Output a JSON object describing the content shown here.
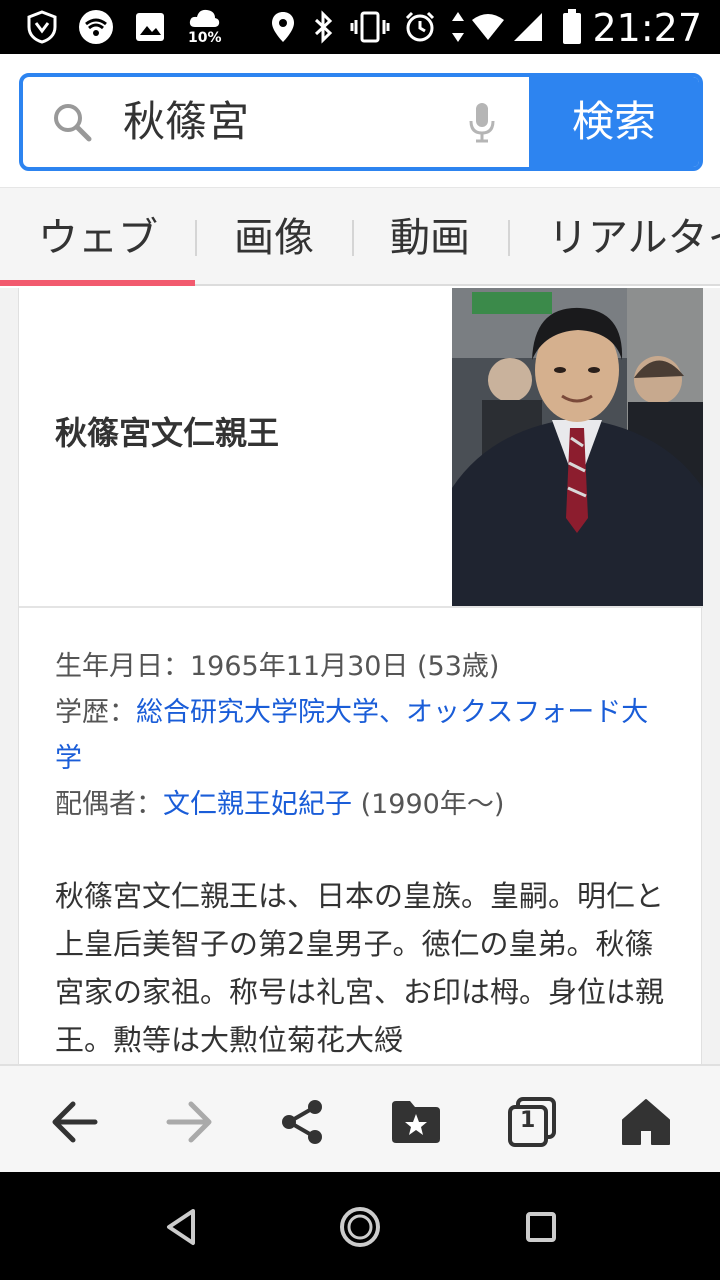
{
  "status_bar": {
    "time": "21:27",
    "battery_saver_text": "10%",
    "icons": [
      "shield-app-icon",
      "wifi-icon",
      "image-icon",
      "weather-icon",
      "location-icon",
      "bluetooth-icon",
      "vibrate-icon",
      "alarm-icon",
      "data-arrows-icon",
      "wifi-signal-icon",
      "cell-signal-icon",
      "battery-icon"
    ]
  },
  "search": {
    "query": "秋篠宮",
    "button_label": "検索"
  },
  "tabs": [
    {
      "label": "ウェブ",
      "active": true
    },
    {
      "label": "画像",
      "active": false
    },
    {
      "label": "動画",
      "active": false
    },
    {
      "label": "リアルタイ",
      "active": false
    }
  ],
  "knowledge_card": {
    "title": "秋篠宮文仁親王",
    "facts": {
      "birth_label": "生年月日：",
      "birth_value": "1965年11月30日 (53歳)",
      "education_label": "学歴：",
      "education_link1": "総合研究大学院大学",
      "education_sep": "、",
      "education_link2": "オックスフォード大学",
      "spouse_label": "配偶者：",
      "spouse_link": "文仁親王妃紀子",
      "spouse_extra": " (1990年〜)"
    },
    "description": "秋篠宮文仁親王は、日本の皇族。皇嗣。明仁と上皇后美智子の第2皇男子。徳仁の皇弟。秋篠宮家の家祖。称号は礼宮、お印は栂。身位は親王。勲等は大勲位菊花大綬"
  },
  "colors": {
    "accent_blue": "#2d84f0",
    "link_blue": "#1a5dd8",
    "tab_underline": "#f25a6e"
  },
  "toolbar": {
    "tabs_count": "1"
  }
}
